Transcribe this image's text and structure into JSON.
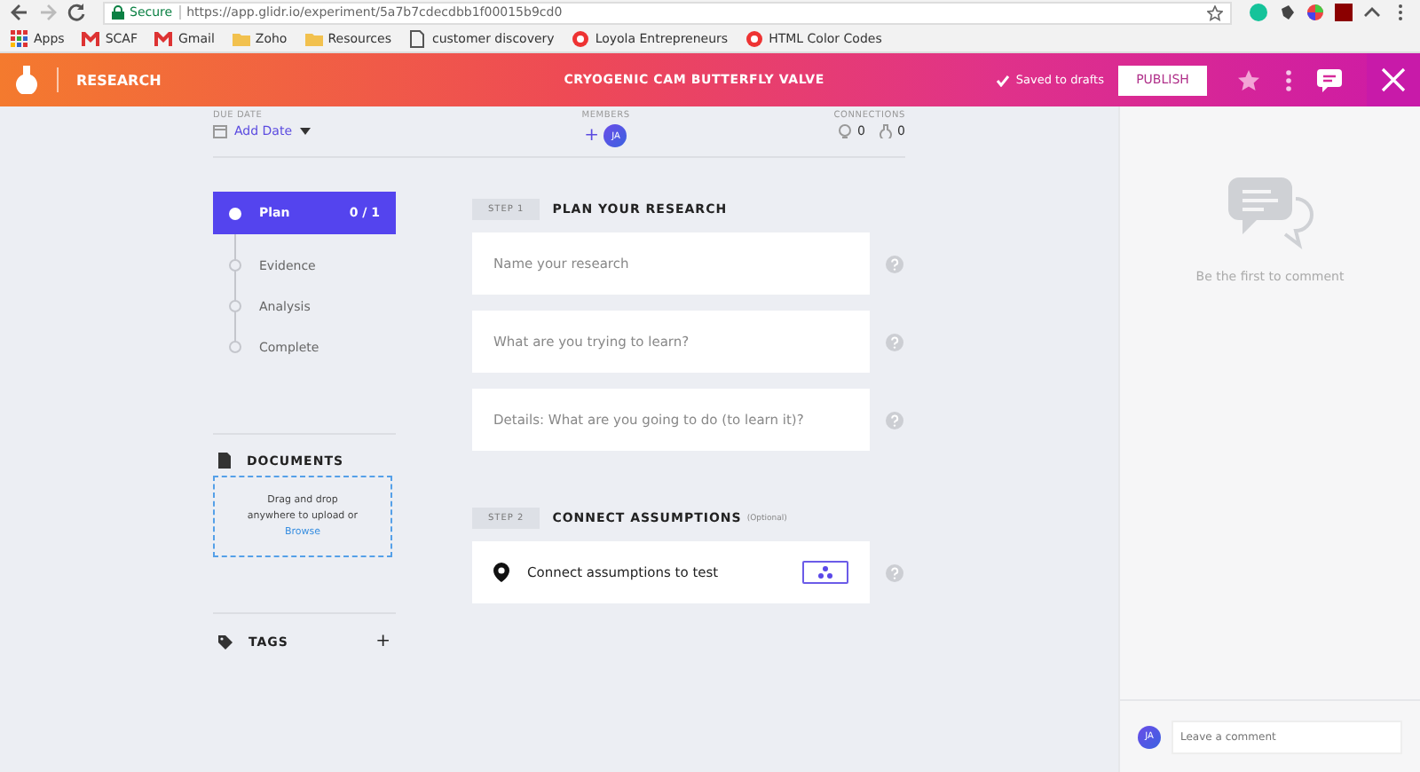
{
  "browser": {
    "secure": "Secure",
    "url": "https://app.glidr.io/experiment/5a7b7cdecdbb1f00015b9cd0",
    "bookmarks": [
      {
        "label": "Apps",
        "kind": "apps"
      },
      {
        "label": "SCAF",
        "kind": "mail"
      },
      {
        "label": "Gmail",
        "kind": "mail"
      },
      {
        "label": "Zoho",
        "kind": "folder"
      },
      {
        "label": "Resources",
        "kind": "folder"
      },
      {
        "label": "customer discovery",
        "kind": "page"
      },
      {
        "label": "Loyola Entrepreneurs",
        "kind": "site"
      },
      {
        "label": "HTML Color Codes",
        "kind": "site"
      }
    ]
  },
  "header": {
    "section": "RESEARCH",
    "title": "CRYOGENIC CAM BUTTERFLY VALVE",
    "saved": "Saved to drafts",
    "publish": "PUBLISH"
  },
  "meta": {
    "due_label": "DUE DATE",
    "due_value": "Add Date",
    "members_label": "MEMBERS",
    "add_member": "+",
    "member": "JA",
    "connections_label": "CONNECTIONS",
    "connections": [
      "0",
      "0"
    ]
  },
  "stages": [
    {
      "label": "Plan",
      "count": "0 / 1",
      "selected": true
    },
    {
      "label": "Evidence",
      "selected": false
    },
    {
      "label": "Analysis",
      "selected": false
    },
    {
      "label": "Complete",
      "selected": false
    }
  ],
  "documents": {
    "title": "DOCUMENTS",
    "drop_text": "Drag and drop anywhere to upload or",
    "browse": "Browse"
  },
  "tags": {
    "title": "TAGS",
    "add": "+"
  },
  "steps": [
    {
      "step": "STEP 1",
      "title": "PLAN YOUR RESEARCH",
      "items": [
        {
          "kind": "field",
          "placeholder": "Name your research"
        },
        {
          "kind": "field",
          "placeholder": "What are you trying to learn?"
        },
        {
          "kind": "field",
          "placeholder": "Details: What are you going to do (to learn it)?"
        }
      ]
    },
    {
      "step": "STEP 2",
      "title": "CONNECT ASSUMPTIONS",
      "note": "(Optional)",
      "items": [
        {
          "kind": "connect",
          "label": "Connect assumptions to test"
        }
      ]
    }
  ],
  "comments": {
    "empty": "Be the first to comment",
    "avatar": "JA",
    "placeholder": "Leave a comment"
  }
}
